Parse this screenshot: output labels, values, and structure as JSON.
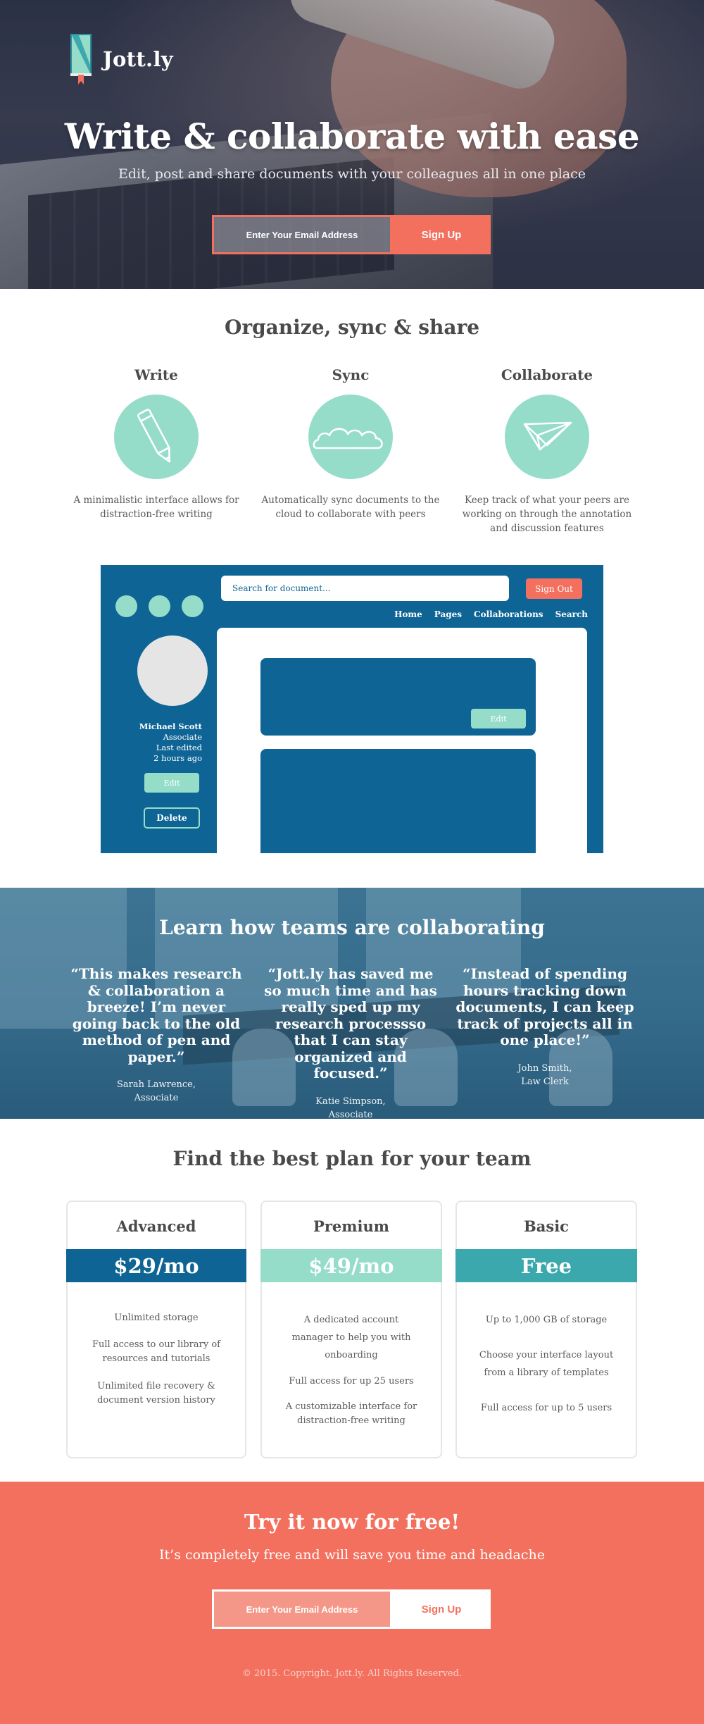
{
  "brand": {
    "name": "Jott.ly",
    "accent": "#f3705e",
    "mint": "#95ddc9",
    "navy": "#0e6494",
    "teal": "#3aa8ad"
  },
  "hero": {
    "title": "Write & collaborate with ease",
    "subtitle": "Edit, post and share documents with your colleagues all in one place",
    "email_placeholder": "Enter Your Email Address",
    "signup_label": "Sign Up"
  },
  "features": {
    "title": "Organize, sync & share",
    "items": [
      {
        "title": "Write",
        "icon": "pencil-icon",
        "text": "A minimalistic interface allows for distraction-free writing"
      },
      {
        "title": "Sync",
        "icon": "cloud-icon",
        "text": "Automatically sync documents to the cloud to collaborate with peers"
      },
      {
        "title": "Collaborate",
        "icon": "paper-plane-icon",
        "text": "Keep track of what your peers are working on through the annotation and discussion features"
      }
    ]
  },
  "app_mock": {
    "search_placeholder": "Search for document...",
    "signout_label": "Sign Out",
    "nav": [
      "Home",
      "Pages",
      "Collaborations",
      "Search"
    ],
    "profile": {
      "name": "Michael Scott",
      "role": "Associate",
      "edited_label": "Last edited",
      "edited_time": "2 hours ago"
    },
    "edit_label": "Edit",
    "delete_label": "Delete",
    "card_edit_label": "Edit"
  },
  "testimonials": {
    "title": "Learn how teams are collaborating",
    "items": [
      {
        "quote": "“This makes research & collaboration a breeze! I’m never going back to the old method of pen and paper.”",
        "name": "Sarah Lawrence,",
        "role": "Associate"
      },
      {
        "quote": "“Jott.ly has saved me so much time and has really sped up my research processso that I can stay organized and focused.”",
        "name": "Katie Simpson,",
        "role": "Associate"
      },
      {
        "quote": "“Instead of spending hours tracking down documents, I can keep track of projects all in one place!”",
        "name": "John Smith,",
        "role": "Law Clerk"
      }
    ]
  },
  "pricing": {
    "title": "Find the best plan for your team",
    "plans": [
      {
        "name": "Advanced",
        "price": "$29/mo",
        "color": "#0e6494",
        "features": [
          "Unlimited storage",
          "Full access to our library of resources and tutorials",
          "Unlimited file recovery & document version history"
        ]
      },
      {
        "name": "Premium",
        "price": "$49/mo",
        "color": "#95ddc9",
        "features": [
          "A dedicated account manager to help you with onboarding",
          "Full access for up 25 users",
          "A customizable interface for distraction-free writing"
        ]
      },
      {
        "name": "Basic",
        "price": "Free",
        "color": "#3aa8ad",
        "features": [
          "Up to 1,000 GB of storage",
          "Choose your interface layout from a library of templates",
          "Full access for up to 5 users"
        ]
      }
    ]
  },
  "cta": {
    "title": "Try it now for free!",
    "subtitle": "It’s completely free and will save you time and headache",
    "email_placeholder": "Enter Your Email Address",
    "signup_label": "Sign Up"
  },
  "footer": {
    "copyright": "© 2015. Copyright. Jott.ly. All  Rights Reserved."
  }
}
